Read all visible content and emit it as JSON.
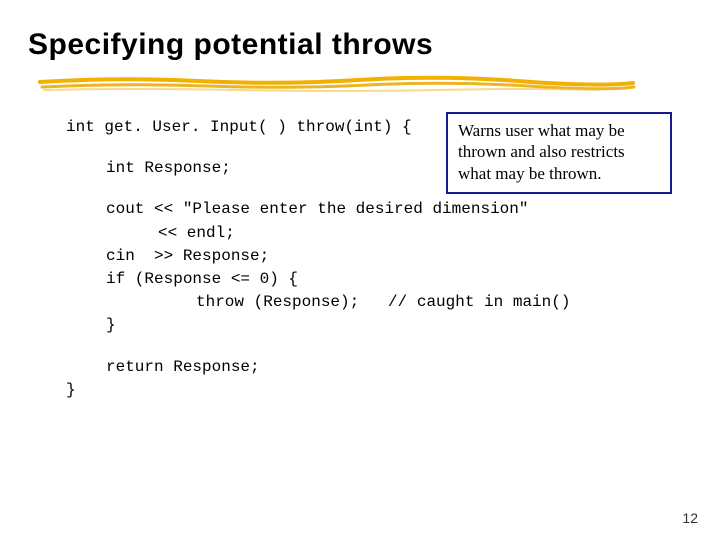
{
  "slide": {
    "title": "Specifying potential throws",
    "page_number": "12"
  },
  "callout": {
    "text": "Warns user what may be thrown and also restricts what may be thrown."
  },
  "code": {
    "line1": "int get. User. Input( ) throw(int) {",
    "line2": "int Response;",
    "line3": "cout << \"Please enter the desired dimension\"",
    "line4": "<< endl;",
    "line5": "cin  >> Response;",
    "line6": "if (Response <= 0) {",
    "line7": "throw (Response);   // caught in main()",
    "line8": "}",
    "line9": "return Response;",
    "line10": "}"
  }
}
